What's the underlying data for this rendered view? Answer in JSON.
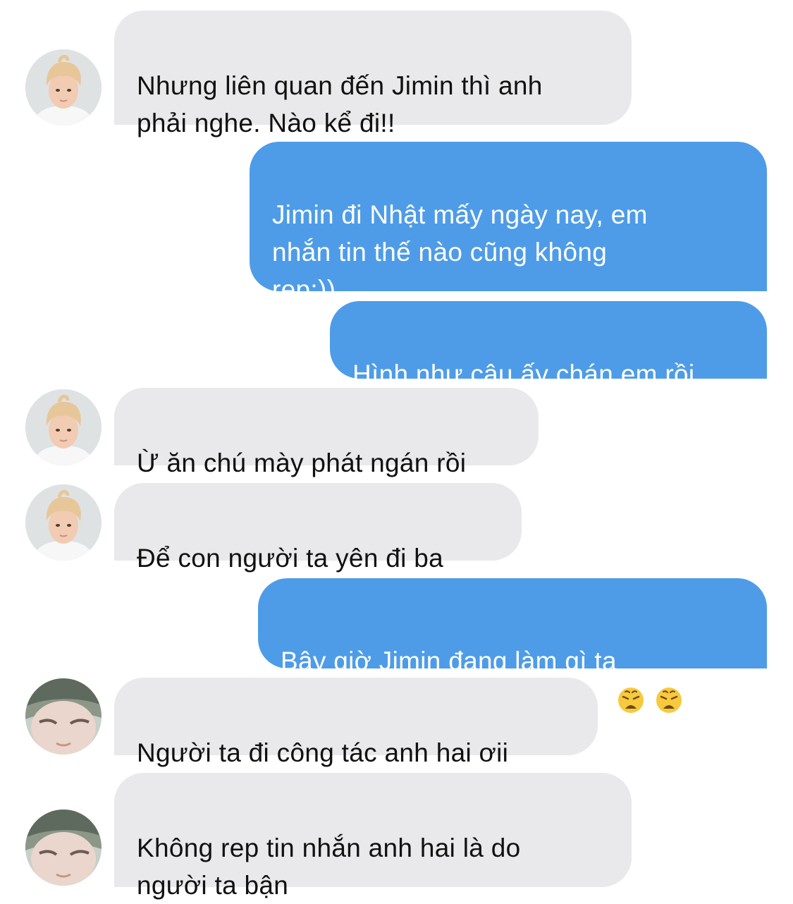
{
  "messages": [
    {
      "side": "in",
      "avatar": "blonde-person-avatar",
      "text": "Nhưng liên quan đến Jimin thì anh\nphải nghe. Nào kể đi!!"
    },
    {
      "side": "out",
      "text": "Jimin đi Nhật mấy ngày nay, em\nnhắn tin thế nào cũng không\nrep:))"
    },
    {
      "side": "out",
      "text": "Hình như cậu ấy chán em rồi"
    },
    {
      "side": "in",
      "avatar": "blonde-person-avatar",
      "text": "Ừ ăn chú mày phát ngán rồi"
    },
    {
      "side": "in",
      "avatar": "blonde-person-avatar",
      "text": "Để con người ta yên đi ba"
    },
    {
      "side": "out",
      "text": "Bây giờ Jimin đang làm gì ta",
      "emoji": [
        "weary-face-emoji",
        "weary-face-emoji"
      ]
    },
    {
      "side": "in",
      "avatar": "blurry-person-avatar",
      "text": "Người ta đi công tác anh hai ơii"
    },
    {
      "side": "in",
      "avatar": "blurry-person-avatar",
      "text": "Không rep tin nhắn anh hai là do\nngười ta bận"
    }
  ],
  "colors": {
    "incoming_bubble": "#e9e9eb",
    "outgoing_bubble": "#4e9ce7",
    "incoming_text": "#111111",
    "outgoing_text": "#ffffff"
  }
}
